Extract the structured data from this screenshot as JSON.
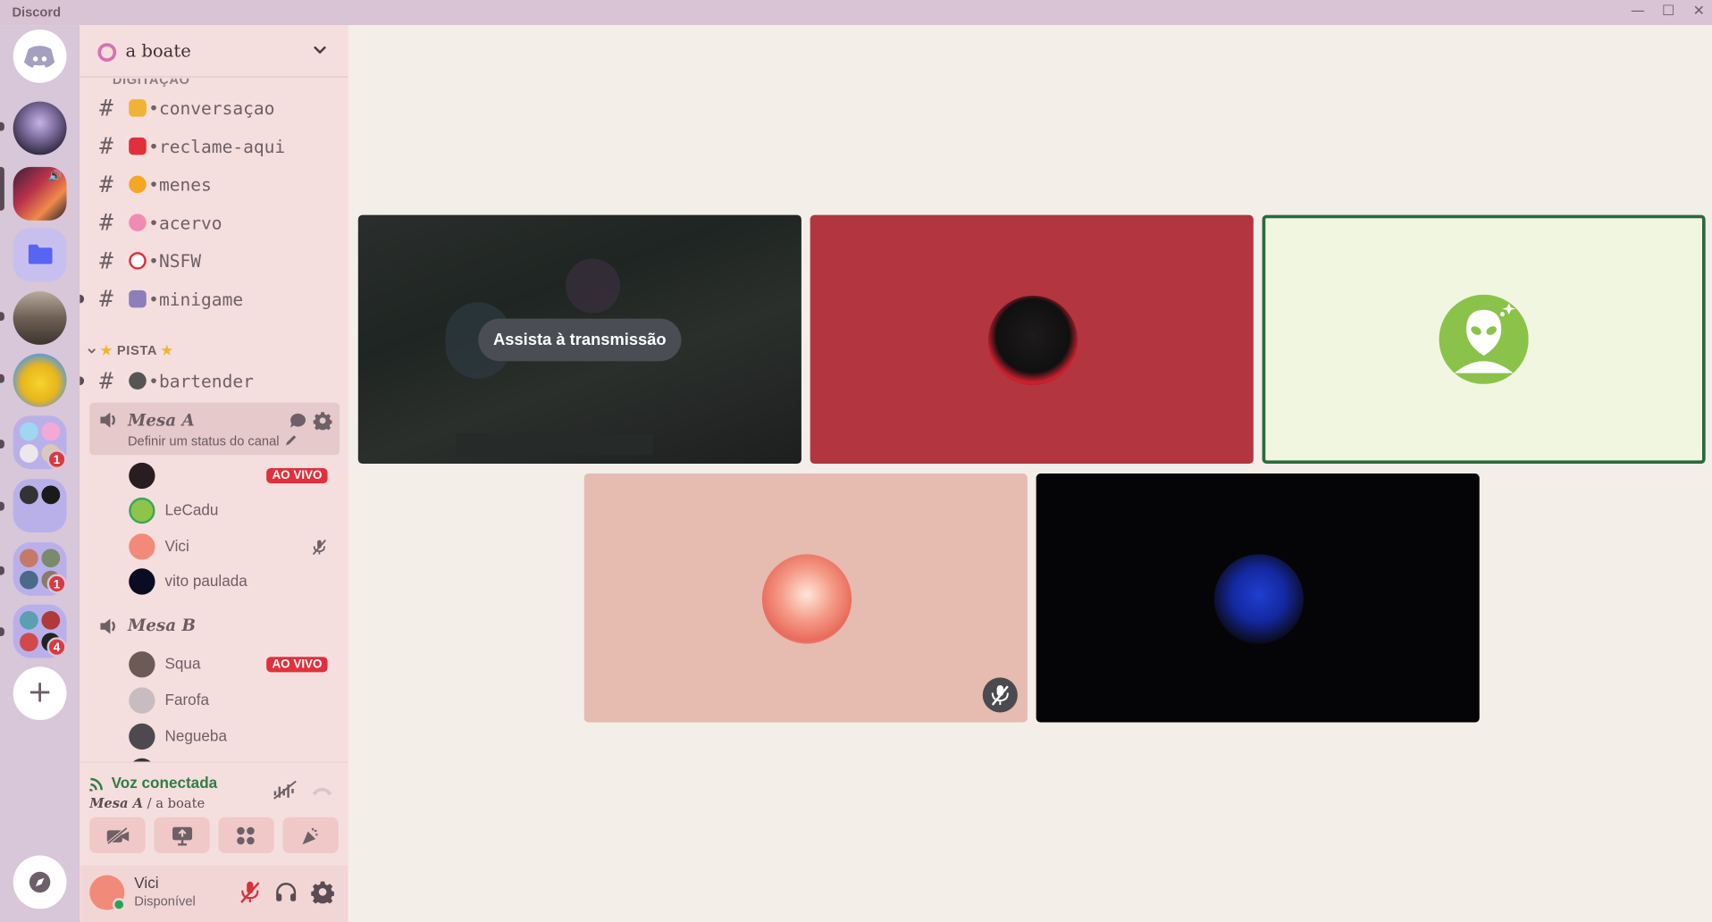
{
  "window": {
    "app_name": "Discord",
    "minimize": "—",
    "maximize": "☐",
    "close": "✕"
  },
  "rail": {
    "badges": [
      "1",
      "1",
      "4"
    ],
    "add_server": "+"
  },
  "server": {
    "name": "a boate"
  },
  "channels": {
    "partial_category": "DIGITAÇÃO",
    "text": [
      {
        "name": "•conversaçao",
        "emoji_color": "#f2b233"
      },
      {
        "name": "•reclame-aqui",
        "emoji_color": "#e0303c"
      },
      {
        "name": "•menes",
        "emoji_color": "#f5a623"
      },
      {
        "name": "•acervo",
        "emoji_color": "#f28bb4"
      },
      {
        "name": "•NSFW",
        "emoji_color": "#e0303c"
      },
      {
        "name": "•minigame",
        "emoji_color": "#8a7fb8"
      }
    ],
    "category_pista": "PISTA",
    "pista_text": {
      "name": "•bartender",
      "emoji_color": "#555555"
    },
    "mesa_a": {
      "name": "Mesa A",
      "status_placeholder": "Definir um status do canal",
      "users": [
        {
          "name": "",
          "live": "AO VIVO",
          "color": "#2a1d22"
        },
        {
          "name": "LeCadu",
          "live": "",
          "color": "#8fc44a"
        },
        {
          "name": "Vici",
          "live": "",
          "color": "#f28a7a"
        },
        {
          "name": "vito paulada",
          "live": "",
          "color": "#0b0b22"
        }
      ]
    },
    "mesa_b": {
      "name": "Mesa B",
      "users": [
        {
          "name": "Squa",
          "live": "AO VIVO",
          "color": "#6b5a55"
        },
        {
          "name": "Farofa",
          "live": "",
          "color": "#c9bcc0"
        },
        {
          "name": "Negueba",
          "live": "",
          "color": "#4c4a4f"
        }
      ]
    }
  },
  "voice": {
    "status": "Voz conectada",
    "channel": "Mesa A",
    "separator": " / ",
    "server": "a boate"
  },
  "user": {
    "name": "Vici",
    "status": "Disponível"
  },
  "stage": {
    "watch_stream_label": "Assista à transmissão"
  },
  "colors": {
    "tile_red": "#b2353f",
    "tile_lime": "#f1f6e1",
    "tile_pink": "#e6bbb0",
    "tile_black": "#050508",
    "speaking_border": "#2a6a3e",
    "voice_green": "#2f7d45"
  }
}
